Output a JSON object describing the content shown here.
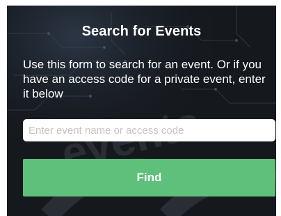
{
  "form": {
    "title": "Search for Events",
    "description": "Use this form to search for an event. Or if you have an access code for a private event, enter it below",
    "search_placeholder": "Enter event name or access code",
    "search_value": "",
    "find_label": "Find"
  },
  "background": {
    "watermark_text": "events"
  },
  "colors": {
    "panel_background": "#15181d",
    "button_green": "#5ec07a",
    "text_white": "#ffffff",
    "placeholder_gray": "#c4c4c4"
  }
}
